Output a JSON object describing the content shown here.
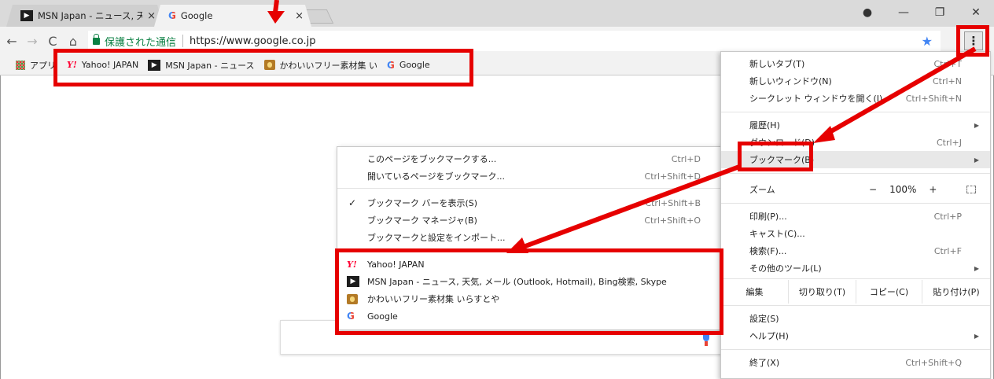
{
  "tabs": [
    {
      "title": "MSN Japan - ニュース, 天気",
      "active": false
    },
    {
      "title": "Google",
      "active": true
    }
  ],
  "toolbar": {
    "secure_label": "保護された通信",
    "url": "https://www.google.co.jp",
    "back_icon": "back-arrow-icon",
    "forward_icon": "forward-arrow-icon",
    "reload_icon": "reload-icon",
    "home_icon": "home-icon"
  },
  "bookmarks_bar": {
    "apps_label": "アプリ",
    "items": [
      {
        "label": "Yahoo! JAPAN",
        "icon": "yahoo-icon"
      },
      {
        "label": "MSN Japan - ニュース",
        "icon": "msn-icon"
      },
      {
        "label": "かわいいフリー素材集 い",
        "icon": "irasutoya-icon"
      },
      {
        "label": "Google",
        "icon": "google-icon"
      }
    ]
  },
  "main_menu": {
    "new_tab": "新しいタブ(T)",
    "new_tab_sc": "Ctrl+T",
    "new_window": "新しいウィンドウ(N)",
    "new_window_sc": "Ctrl+N",
    "incognito": "シークレット ウィンドウを開く(I)",
    "incognito_sc": "Ctrl+Shift+N",
    "history": "履歴(H)",
    "downloads": "ダウンロード(D)",
    "downloads_sc": "Ctrl+J",
    "bookmarks": "ブックマーク(B)",
    "zoom": "ズーム",
    "zoom_minus": "−",
    "zoom_level": "100%",
    "zoom_plus": "+",
    "print": "印刷(P)...",
    "print_sc": "Ctrl+P",
    "cast": "キャスト(C)...",
    "find": "検索(F)...",
    "find_sc": "Ctrl+F",
    "more_tools": "その他のツール(L)",
    "edit": "編集",
    "cut": "切り取り(T)",
    "copy": "コピー(C)",
    "paste": "貼り付け(P)",
    "settings": "設定(S)",
    "help": "ヘルプ(H)",
    "exit": "終了(X)",
    "exit_sc": "Ctrl+Shift+Q"
  },
  "bookmarks_submenu": {
    "bookmark_page": "このページをブックマークする...",
    "bookmark_page_sc": "Ctrl+D",
    "bookmark_open": "開いているページをブックマーク...",
    "bookmark_open_sc": "Ctrl+Shift+D",
    "show_bar": "ブックマーク バーを表示(S)",
    "show_bar_sc": "Ctrl+Shift+B",
    "manager": "ブックマーク マネージャ(B)",
    "manager_sc": "Ctrl+Shift+O",
    "import": "ブックマークと設定をインポート...",
    "items": [
      {
        "label": "Yahoo! JAPAN",
        "icon": "yahoo-icon"
      },
      {
        "label": "MSN Japan - ニュース, 天気, メール (Outlook, Hotmail), Bing検索, Skype",
        "icon": "msn-icon"
      },
      {
        "label": "かわいいフリー素材集 いらすとや",
        "icon": "irasutoya-icon"
      },
      {
        "label": "Google",
        "icon": "google-icon"
      }
    ]
  },
  "colors": {
    "annotation_red": "#e60000",
    "secure_green": "#0b8043",
    "star_blue": "#4285f4"
  }
}
